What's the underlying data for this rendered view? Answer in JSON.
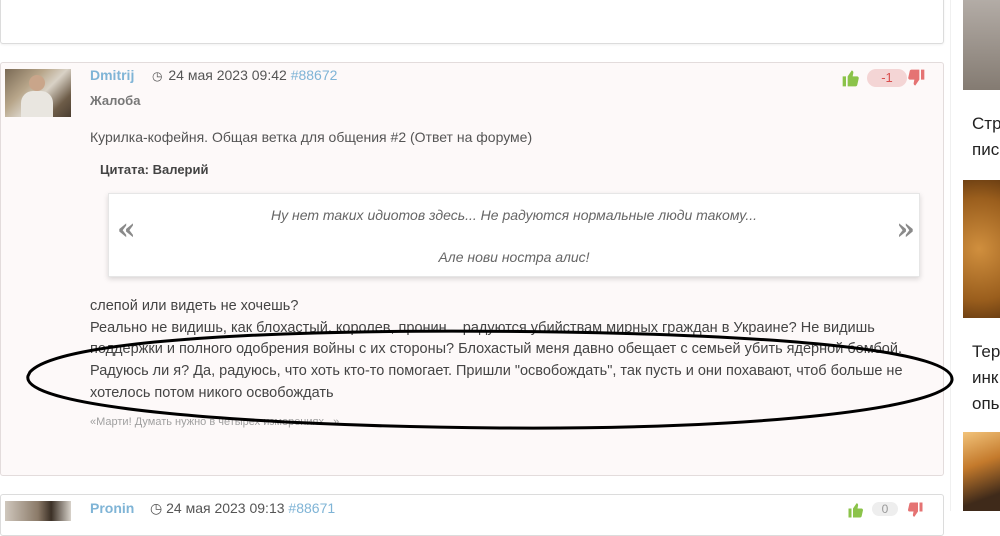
{
  "post": {
    "username": "Dmitrij",
    "date": "24 мая 2023 09:42",
    "post_number": "#88672",
    "complaint_label": "Жалоба",
    "score": "-1",
    "topic": "Курилка-кофейня. Общая ветка для общения #2 (Ответ на форуме)",
    "quote_author": "Цитата: Валерий",
    "quote_lines": [
      "Ну нет таких идиотов здесь... Не радуются нормальные люди такому...",
      "Але нови ностра алис!"
    ],
    "quote_open": "«",
    "quote_close": "»",
    "body_lines": [
      "слепой или видеть не хочешь?",
      "Реально не видишь, как блохастый, королев, пронин... радуются убийствам мирных граждан в Украине? Не видишь",
      "поддержки и полного одобрения войны с их стороны? Блохастый меня давно обещает с семьей убить ядерной бомбой.",
      "Радуюсь ли я? Да, радуюсь, что хоть кто-то помогает. Пришли \"освобождать\", так пусть и они похавают, чтоб больше не",
      "хотелось потом никого освобождать"
    ],
    "signature": "«Марти! Думать нужно в четырех измерениях...»"
  },
  "next_post": {
    "username": "Pronin",
    "date": "24 мая 2023 09:13",
    "post_number": "#88671",
    "score": "0"
  },
  "sidebar": {
    "texts": [
      [
        "Стр",
        "пис"
      ],
      [
        "Тер",
        "инк",
        "опь"
      ]
    ]
  },
  "colors": {
    "link": "#7fb4d6",
    "thumb_up": "#8bc34a",
    "thumb_down": "#e57373",
    "score_bg": "#f4d5d5",
    "score_text": "#d94f4f"
  },
  "icons": [
    "clock-icon",
    "thumbs-up-icon",
    "thumbs-down-icon"
  ]
}
